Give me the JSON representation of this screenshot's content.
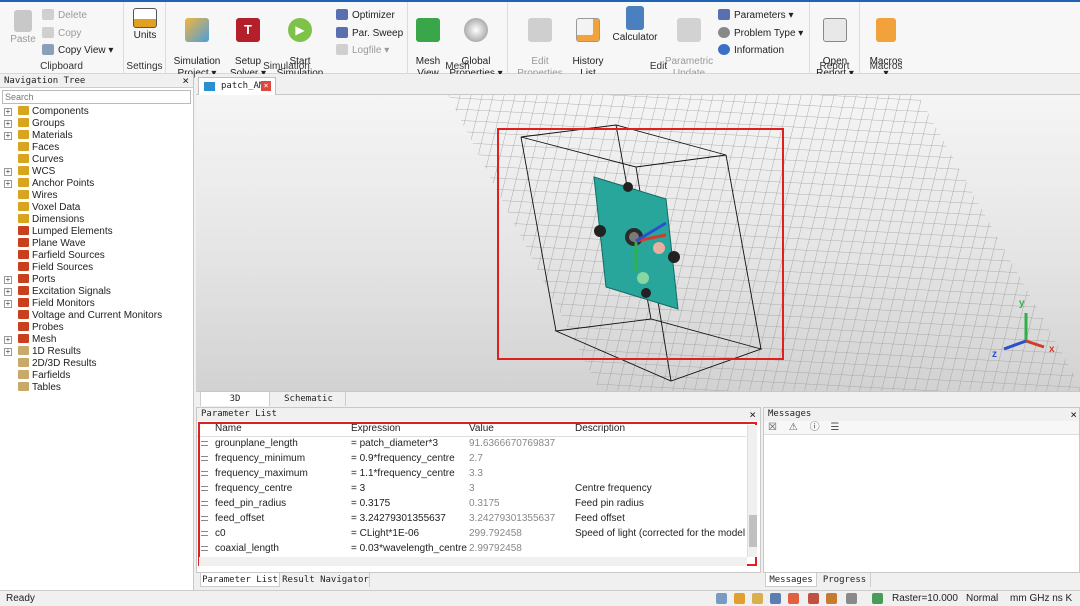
{
  "ribbon": {
    "clipboard": {
      "group_label": "Clipboard",
      "paste": "Paste",
      "delete": "Delete",
      "copy": "Copy",
      "copy_view": "Copy View ▾"
    },
    "settings": {
      "group_label": "Settings",
      "units": "Units"
    },
    "simulation": {
      "group_label": "Simulation",
      "simulation_project": "Simulation\nProject ▾",
      "setup_solver": "Setup\nSolver ▾",
      "start_simulation": "Start\nSimulation",
      "optimizer": "Optimizer",
      "par_sweep": "Par. Sweep",
      "logfile": "Logfile ▾"
    },
    "mesh": {
      "group_label": "Mesh",
      "mesh_view": "Mesh\nView",
      "global_properties": "Global\nProperties ▾"
    },
    "edit": {
      "group_label": "Edit",
      "edit_properties": "Edit\nProperties",
      "history_list": "History\nList",
      "calculator": "Calculator",
      "parametric_update": "Parametric\nUpdate",
      "parameters": "Parameters ▾",
      "problem_type": "Problem Type ▾",
      "information": "Information"
    },
    "report": {
      "group_label": "Report",
      "open_report": "Open\nReport ▾"
    },
    "macros": {
      "group_label": "Macros",
      "macros": "Macros\n▾"
    }
  },
  "nav": {
    "title": "Navigation Tree",
    "close": "×",
    "search_placeholder": "Search",
    "items": [
      {
        "label": "Components",
        "expandable": true,
        "icon_color": "#d9a520"
      },
      {
        "label": "Groups",
        "expandable": true,
        "icon_color": "#d9a520"
      },
      {
        "label": "Materials",
        "expandable": true,
        "icon_color": "#d9a520"
      },
      {
        "label": "Faces",
        "expandable": false,
        "icon_color": "#d9a520"
      },
      {
        "label": "Curves",
        "expandable": false,
        "icon_color": "#d9a520"
      },
      {
        "label": "WCS",
        "expandable": true,
        "icon_color": "#d9a520"
      },
      {
        "label": "Anchor Points",
        "expandable": true,
        "icon_color": "#d9a520"
      },
      {
        "label": "Wires",
        "expandable": false,
        "icon_color": "#d9a520"
      },
      {
        "label": "Voxel Data",
        "expandable": false,
        "icon_color": "#d9a520"
      },
      {
        "label": "Dimensions",
        "expandable": false,
        "icon_color": "#d9a520"
      },
      {
        "label": "Lumped Elements",
        "expandable": false,
        "icon_color": "#c8401e"
      },
      {
        "label": "Plane Wave",
        "expandable": false,
        "icon_color": "#c8401e"
      },
      {
        "label": "Farfield Sources",
        "expandable": false,
        "icon_color": "#c8401e"
      },
      {
        "label": "Field Sources",
        "expandable": false,
        "icon_color": "#c8401e"
      },
      {
        "label": "Ports",
        "expandable": true,
        "icon_color": "#c8401e"
      },
      {
        "label": "Excitation Signals",
        "expandable": true,
        "icon_color": "#c8401e"
      },
      {
        "label": "Field Monitors",
        "expandable": true,
        "icon_color": "#c8401e"
      },
      {
        "label": "Voltage and Current Monitors",
        "expandable": false,
        "icon_color": "#c8401e"
      },
      {
        "label": "Probes",
        "expandable": false,
        "icon_color": "#c8401e"
      },
      {
        "label": "Mesh",
        "expandable": true,
        "icon_color": "#c8401e"
      },
      {
        "label": "1D Results",
        "expandable": true,
        "icon_color": "#c9a96a"
      },
      {
        "label": "2D/3D Results",
        "expandable": false,
        "icon_color": "#c9a96a"
      },
      {
        "label": "Farfields",
        "expandable": false,
        "icon_color": "#c9a96a"
      },
      {
        "label": "Tables",
        "expandable": false,
        "icon_color": "#c9a96a"
      }
    ]
  },
  "document_tab": {
    "label": "patch_AM",
    "close": "×"
  },
  "view_tabs": {
    "tab_3d": "3D",
    "tab_schematic": "Schematic"
  },
  "axes": {
    "x": "x",
    "y": "y",
    "z": "z"
  },
  "param_list": {
    "title": "Parameter List",
    "close": "×",
    "columns": {
      "name": "Name",
      "expression": "Expression",
      "value": "Value",
      "description": "Description"
    },
    "rows": [
      {
        "name": "grounplane_length",
        "expression": "= patch_diameter*3",
        "value": "91.6366670769837",
        "description": ""
      },
      {
        "name": "frequency_minimum",
        "expression": "= 0.9*frequency_centre",
        "value": "2.7",
        "description": ""
      },
      {
        "name": "frequency_maximum",
        "expression": "= 1.1*frequency_centre",
        "value": "3.3",
        "description": ""
      },
      {
        "name": "frequency_centre",
        "expression": "= 3",
        "value": "3",
        "description": "Centre frequency"
      },
      {
        "name": "feed_pin_radius",
        "expression": "= 0.3175",
        "value": "0.3175",
        "description": "Feed pin radius"
      },
      {
        "name": "feed_offset",
        "expression": "= 3.24279301355637",
        "value": "3.24279301355637",
        "description": "Feed offset"
      },
      {
        "name": "c0",
        "expression": "= CLight*1E-06",
        "value": "299.792458",
        "description": "Speed of light (corrected for the model"
      },
      {
        "name": "coaxial_length",
        "expression": "= 0.03*wavelength_centre",
        "value": "2.99792458",
        "description": ""
      }
    ],
    "tabs": {
      "parameter_list": "Parameter List",
      "result_navigator": "Result Navigator"
    }
  },
  "messages": {
    "title": "Messages",
    "close": "×",
    "tabs": {
      "messages": "Messages",
      "progress": "Progress"
    }
  },
  "status": {
    "left": "Ready",
    "raster": "Raster=10.000",
    "mode": "Normal",
    "units": "mm  GHz  ns  K"
  }
}
